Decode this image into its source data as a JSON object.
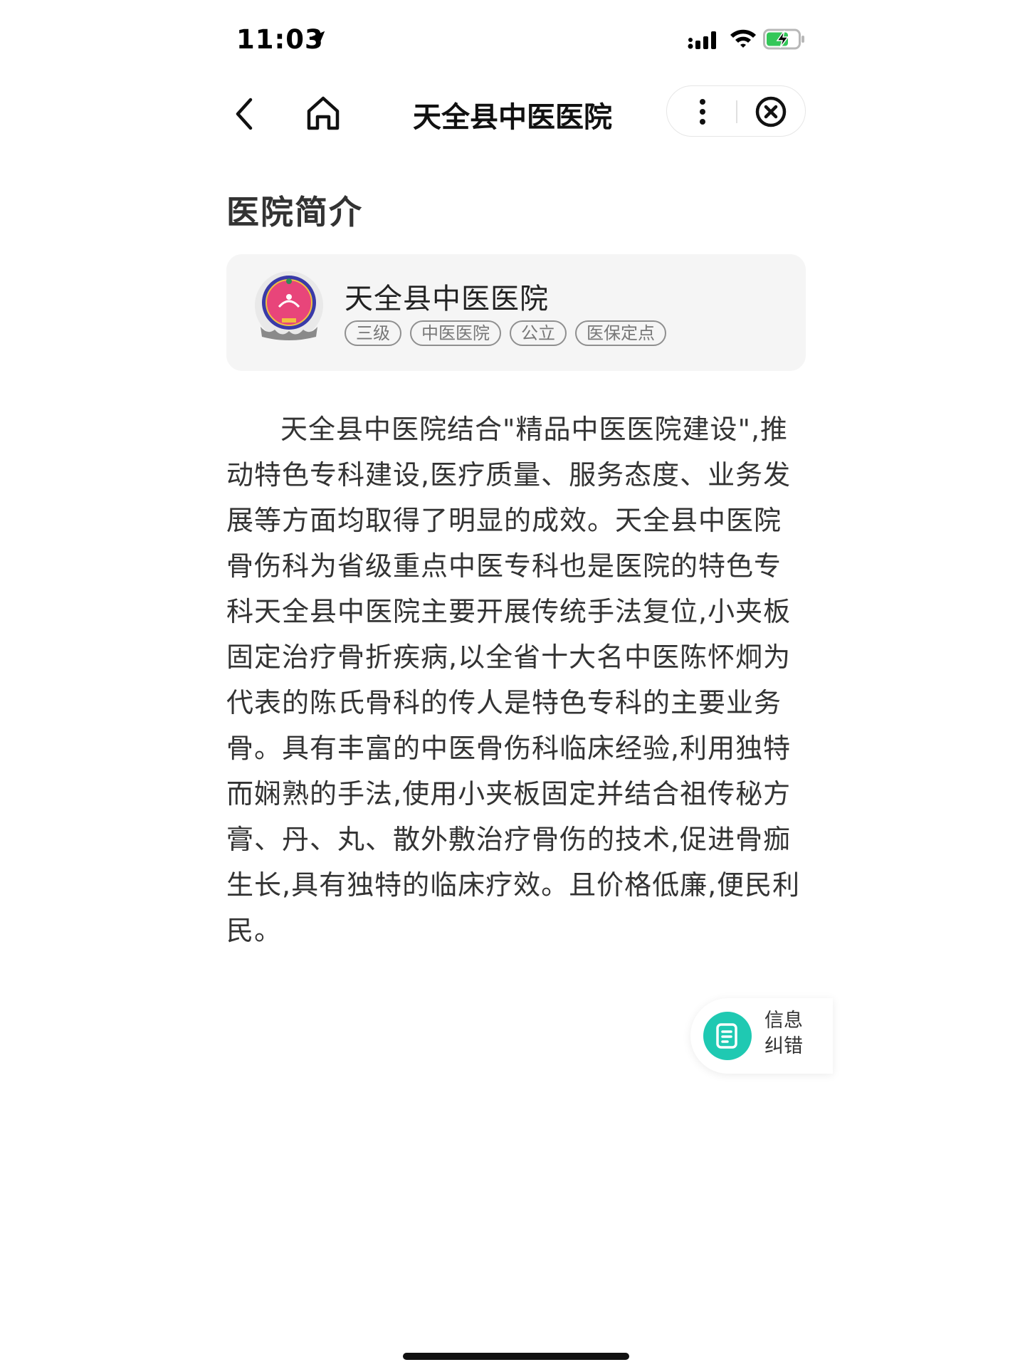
{
  "status_bar": {
    "time": "11:03",
    "icons": [
      "location-arrow-icon",
      "signal-icon",
      "wifi-icon",
      "battery-charging-icon"
    ],
    "battery_color": "#34c759"
  },
  "nav": {
    "title": "天全县中医医院",
    "icons": [
      "back-icon",
      "home-icon",
      "more-icon",
      "close-icon"
    ]
  },
  "section": {
    "title": "医院简介"
  },
  "hospital": {
    "name": "天全县中医医院",
    "tags": [
      "三级",
      "中医医院",
      "公立",
      "医保定点"
    ],
    "logo_colors": [
      "#e8457a",
      "#3a3aa8"
    ]
  },
  "description": "天全县中医院结合\"精品中医医院建设\",推动特色专科建设,医疗质量、服务态度、业务发展等方面均取得了明显的成效。天全县中医院骨伤科为省级重点中医专科也是医院的特色专科天全县中医院主要开展传统手法复位,小夹板固定治疗骨折疾病,以全省十大名中医陈怀炯为代表的陈氏骨科的传人是特色专科的主要业务骨。具有丰富的中医骨伤科临床经验,利用独特而娴熟的手法,使用小夹板固定并结合祖传秘方膏、丹、丸、散外敷治疗骨伤的技术,促进骨痂生长,具有独特的临床疗效。且价格低廉,便民利民。",
  "feedback": {
    "line1": "信息",
    "line2": "纠错",
    "icon": "edit-note-icon",
    "accent": "#1fc9b2"
  }
}
